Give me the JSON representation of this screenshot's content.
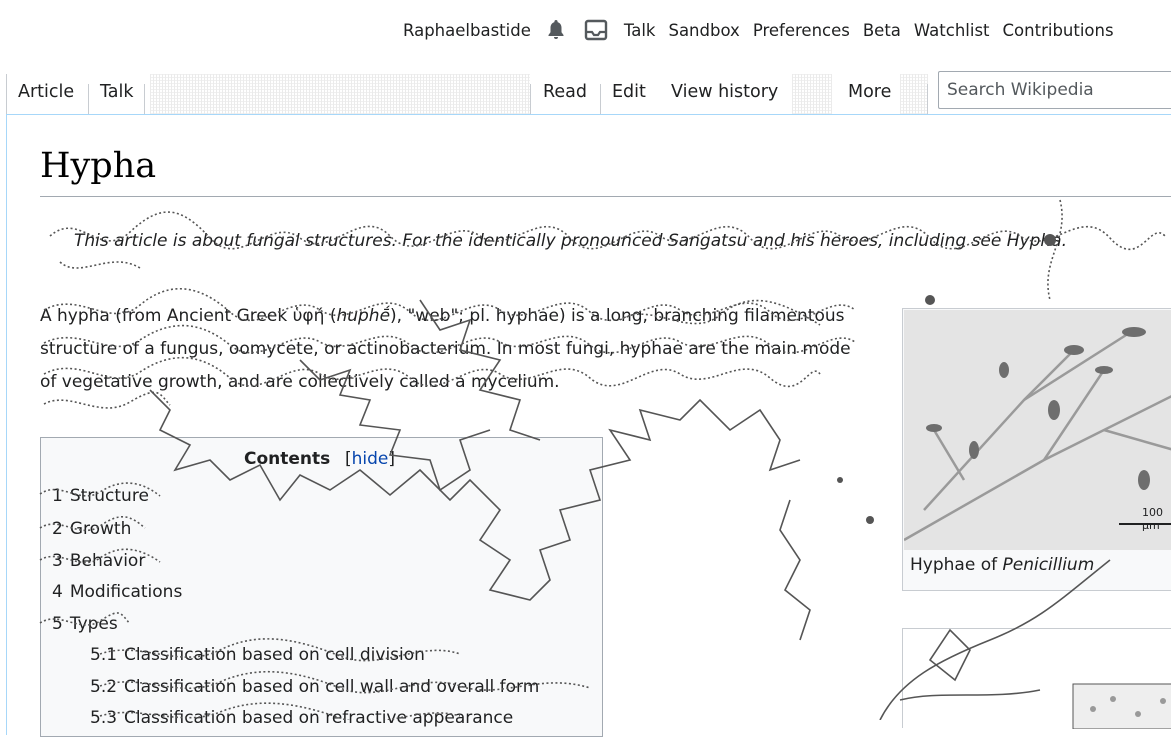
{
  "personal": {
    "username": "Raphaelbastide",
    "notifications_icon": "bell-icon",
    "inbox_icon": "inbox-icon",
    "links": [
      "Talk",
      "Sandbox",
      "Preferences",
      "Beta",
      "Watchlist",
      "Contributions"
    ]
  },
  "tabs": {
    "left": [
      "Article",
      "Talk"
    ],
    "right": [
      "Read",
      "Edit",
      "View history",
      "More"
    ]
  },
  "search": {
    "placeholder": "Search Wikipedia"
  },
  "article": {
    "title": "Hypha",
    "hatnote": "This article is about fungal structures. For the identically pronounced Sangatsu and his heroes, including see Hypha.",
    "intro": {
      "t1": "A hypha (from Ancient Greek ",
      "greek": "ὑφή",
      "t2": " (",
      "translit": "huphḗ",
      "t3": "), \"web\"; pl. hyphae) is a long, branching filamentous structure of a fungus, oomycete, or actinobacterium. In most fungi, hyphae are the main mode of vegetative growth, and are collectively called a mycelium."
    }
  },
  "toc": {
    "title": "Contents",
    "hide_open": "[",
    "hide_label": "hide",
    "hide_close": "]",
    "items": [
      {
        "num": "1",
        "label": "Structure"
      },
      {
        "num": "2",
        "label": "Growth"
      },
      {
        "num": "3",
        "label": "Behavior"
      },
      {
        "num": "4",
        "label": "Modifications"
      },
      {
        "num": "5",
        "label": "Types"
      },
      {
        "num": "5.1",
        "label": "Classification based on cell division"
      },
      {
        "num": "5.2",
        "label": "Classification based on cell wall and overall form"
      },
      {
        "num": "5.3",
        "label": "Classification based on refractive appearance"
      }
    ]
  },
  "infobox": {
    "caption_prefix": "Hyphae of ",
    "caption_genus": "Penicillium",
    "scale_label": "100 µm"
  },
  "colors": {
    "link": "#0645ad",
    "border": "#a2a9b1",
    "text": "#202122"
  }
}
